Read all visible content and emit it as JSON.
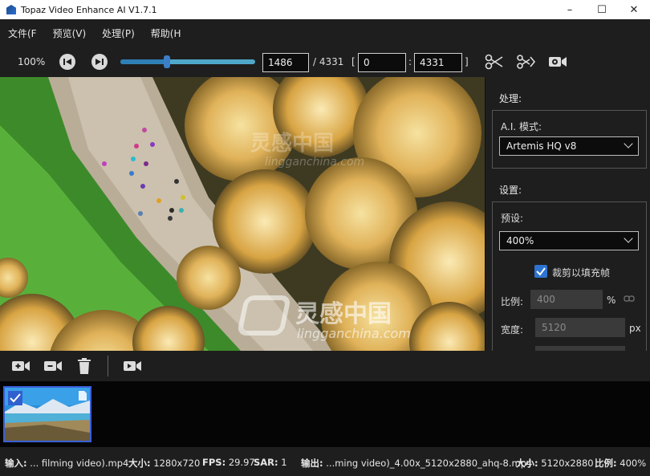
{
  "window": {
    "title": "Topaz Video Enhance AI V1.7.1"
  },
  "menu": [
    {
      "label": "文件(F"
    },
    {
      "label": "预览(V)"
    },
    {
      "label": "处理(P)"
    },
    {
      "label": "帮助(H"
    }
  ],
  "toolbar": {
    "zoom": "100%",
    "current_frame": "1486",
    "total_frames": "/ 4331",
    "range_open": "[",
    "range_start": "0",
    "range_sep": ":",
    "range_end": "4331",
    "range_close": "]",
    "timeline_position": 0.343
  },
  "panel": {
    "process_label": "处理:",
    "ai_mode_label": "A.I. 模式:",
    "ai_mode_value": "Artemis HQ v8",
    "settings_label": "设置:",
    "preset_label": "预设:",
    "preset_value": "400%",
    "crop_label": "裁剪以填充帧",
    "crop_checked": true,
    "scale_label": "比例:",
    "scale_value": "400",
    "scale_unit": "%",
    "width_label": "宽度:",
    "width_value": "5120",
    "width_unit": "px"
  },
  "watermark": {
    "brand_cn": "灵感中国",
    "brand_url": "lingganchina.com"
  },
  "status": {
    "input_label": "输入:",
    "input_file": "... filming video).mp4",
    "size_label": "大小:",
    "size_value": "1280x720",
    "fps_label": "FPS:",
    "fps_value": "29.97",
    "sar_label": "SAR:",
    "sar_value": "1",
    "output_label": "输出:",
    "output_file": "...ming video)_4.00x_5120x2880_ahq-8.mp4",
    "out_size_label": "大小:",
    "out_size_value": "5120x2880",
    "ratio_label": "比例:",
    "ratio_value": "400%"
  },
  "colors": {
    "accent": "#2e73d1",
    "slider": "#4fa8c9",
    "background": "#1e1e1e"
  },
  "icons": [
    "first-frame-icon",
    "last-frame-icon",
    "scissors-icon",
    "split-icon",
    "preview-camera-icon",
    "add-video-icon",
    "remove-video-icon",
    "trash-icon",
    "export-video-icon",
    "checkmark-icon",
    "link-icon"
  ]
}
